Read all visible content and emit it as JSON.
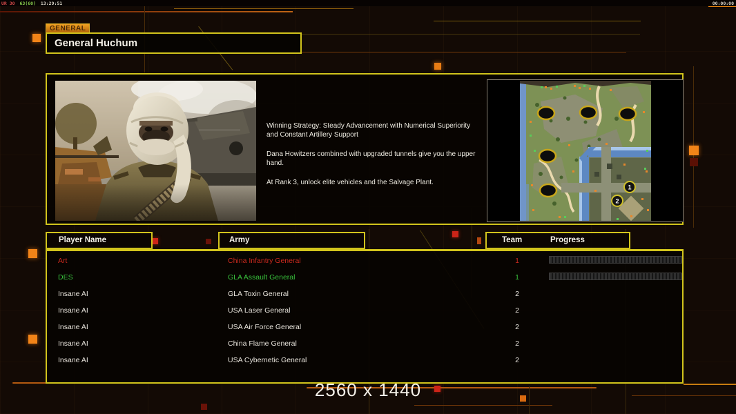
{
  "overlay": {
    "fps_app": "UR 30",
    "fps_rate": "63(60)",
    "fps_clock": "13:29:51",
    "match_timer": "00:00:00"
  },
  "header": {
    "tab_label": "GENERAL",
    "title": "General Huchum"
  },
  "briefing": {
    "paragraphs": [
      "Winning Strategy: Steady Advancement with Numerical Superiority\n and Constant Artillery Support",
      "Dana Howitzers combined with upgraded tunnels give you the upper\n hand.",
      "At Rank 3, unlock elite vehicles and the Salvage Plant."
    ]
  },
  "map": {
    "markers": [
      "1",
      "2"
    ]
  },
  "table": {
    "headers": {
      "player": "Player Name",
      "army": "Army",
      "team": "Team",
      "progress": "Progress"
    },
    "rows": [
      {
        "player": "Art",
        "army": "China Infantry General",
        "team": "1",
        "color": "#cc2a1e",
        "has_progress": true
      },
      {
        "player": "DES",
        "army": "GLA Assault General",
        "team": "1",
        "color": "#38c23c",
        "has_progress": true
      },
      {
        "player": "Insane AI",
        "army": "GLA Toxin General",
        "team": "2",
        "color": "#e8e4dc",
        "has_progress": false
      },
      {
        "player": "Insane AI",
        "army": "USA Laser General",
        "team": "2",
        "color": "#e8e4dc",
        "has_progress": false
      },
      {
        "player": "Insane AI",
        "army": "USA Air Force General",
        "team": "2",
        "color": "#e8e4dc",
        "has_progress": false
      },
      {
        "player": "Insane AI",
        "army": "China Flame General",
        "team": "2",
        "color": "#e8e4dc",
        "has_progress": false
      },
      {
        "player": "Insane AI",
        "army": "USA Cybernetic General",
        "team": "2",
        "color": "#e8e4dc",
        "has_progress": false
      }
    ]
  },
  "footer": {
    "resolution": "2560 x 1440"
  },
  "colors": {
    "panel_border": "#d2c41c",
    "accent_orange": "#f28418",
    "accent_red": "#cc2418",
    "background": "#130a05"
  }
}
